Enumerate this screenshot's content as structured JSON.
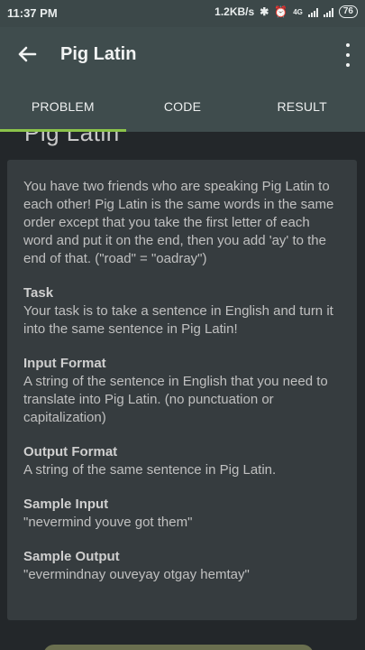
{
  "status_bar": {
    "time": "11:37 PM",
    "speed": "1.2KB/s",
    "battery": "76",
    "network": "4G"
  },
  "app_bar": {
    "title": "Pig Latin"
  },
  "tabs": [
    {
      "label": "PROBLEM",
      "active": true
    },
    {
      "label": "CODE",
      "active": false
    },
    {
      "label": "RESULT",
      "active": false
    }
  ],
  "problem": {
    "heading": "Pig Latin",
    "intro": "You have two friends who are speaking Pig Latin to each other! Pig Latin is the same words in the same order except that you take the first letter of each word and put it on the end, then you add 'ay' to the end of that. (\"road\" = \"oadray\")",
    "sections": [
      {
        "title": "Task",
        "text": "Your task is to take a sentence in English and turn it into the same sentence in Pig Latin!"
      },
      {
        "title": "Input Format",
        "text": "A string of the sentence in English that you need to translate into Pig Latin. (no punctuation or capitalization)"
      },
      {
        "title": "Output Format",
        "text": "A string of the same sentence in Pig Latin."
      },
      {
        "title": "Sample Input",
        "text": "\"nevermind youve got them\""
      },
      {
        "title": "Sample Output",
        "text": "\"evermindnay ouveyay otgay hemtay\""
      }
    ]
  },
  "colors": {
    "accent": "#8bc34a",
    "app_bar": "#3f4c4d",
    "background": "#23272a",
    "card": "#363c3f"
  }
}
